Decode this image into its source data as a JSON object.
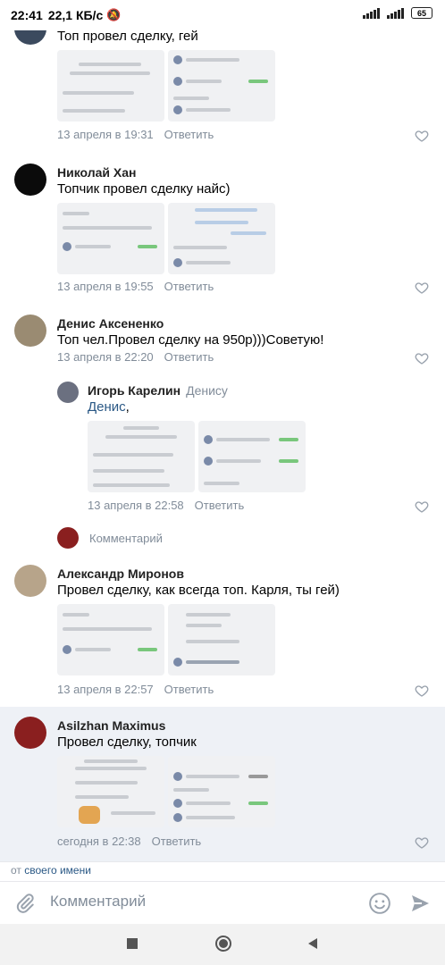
{
  "status_bar": {
    "time": "22:41",
    "network_speed": "22,1 КБ/с",
    "battery": "65"
  },
  "comments": [
    {
      "author": "",
      "text": "Топ провел сделку, гей",
      "date": "13 апреля в 19:31",
      "reply_label": "Ответить",
      "avatar_color": "#3b4a5e"
    },
    {
      "author": "Николай Хан",
      "text": "Топчик провел сделку найс)",
      "date": "13 апреля в 19:55",
      "reply_label": "Ответить",
      "avatar_color": "#0b0b0b"
    },
    {
      "author": "Денис Аксененко",
      "text": "Топ чел.Провел сделку на 950р)))Советую!",
      "date": "13 апреля в 22:20",
      "reply_label": "Ответить",
      "avatar_color": "#9a8b72"
    },
    {
      "author": "Игорь Карелин",
      "reply_to": "Денису",
      "mention": "Денис",
      "text_after_mention": ",",
      "date": "13 апреля в 22:58",
      "reply_label": "Ответить",
      "avatar_color": "#6b7080"
    },
    {
      "author": "Александр Миронов",
      "text": "Провел сделку, как всегда топ. Карля, ты гей)",
      "date": "13 апреля в 22:57",
      "reply_label": "Ответить",
      "avatar_color": "#b7a48a"
    },
    {
      "author": "Asilzhan Maximus",
      "text": "Провел сделку, топчик",
      "date": "сегодня в 22:38",
      "reply_label": "Ответить",
      "avatar_color": "#8a1f1f"
    }
  ],
  "thread_reply": {
    "placeholder": "Комментарий",
    "avatar_color": "#8a1f1f"
  },
  "composer": {
    "from_prefix": "от",
    "from_link": "своего имени",
    "placeholder": "Комментарий"
  },
  "colors": {
    "link": "#2a5885",
    "secondary_text": "#818c99",
    "highlight_bg": "#eef1f6",
    "accent": "#4986cc"
  },
  "icons": [
    "attach-icon",
    "smile-icon",
    "send-icon",
    "heart-icon",
    "nav-square-icon",
    "nav-home-icon",
    "nav-back-icon"
  ]
}
